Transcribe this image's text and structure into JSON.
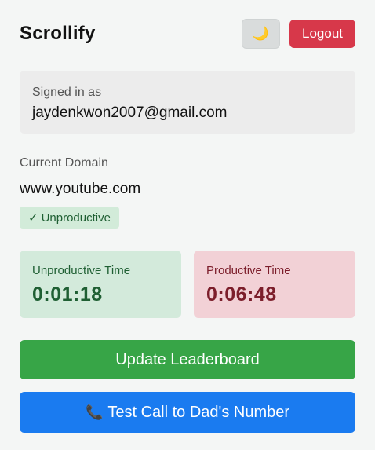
{
  "app": {
    "title": "Scrollify"
  },
  "header": {
    "theme_toggle_icon": "🌙",
    "logout_label": "Logout"
  },
  "account": {
    "signed_in_label": "Signed in as",
    "email": "jaydenkwon2007@gmail.com"
  },
  "domain": {
    "label": "Current Domain",
    "value": "www.youtube.com",
    "status_check": "✓",
    "status_text": "Unproductive"
  },
  "stats": {
    "unproductive_label": "Unproductive Time",
    "unproductive_value": "0:01:18",
    "productive_label": "Productive Time",
    "productive_value": "0:06:48"
  },
  "actions": {
    "update_leaderboard_label": "Update Leaderboard",
    "call_icon": "📞",
    "test_call_label": "Test Call to Dad's Number"
  },
  "colors": {
    "logout": "#d7384a",
    "unproductive_card": "#d3eadb",
    "productive_card": "#f2d1d6",
    "update_button": "#37a547",
    "call_button": "#1a7bf0"
  }
}
